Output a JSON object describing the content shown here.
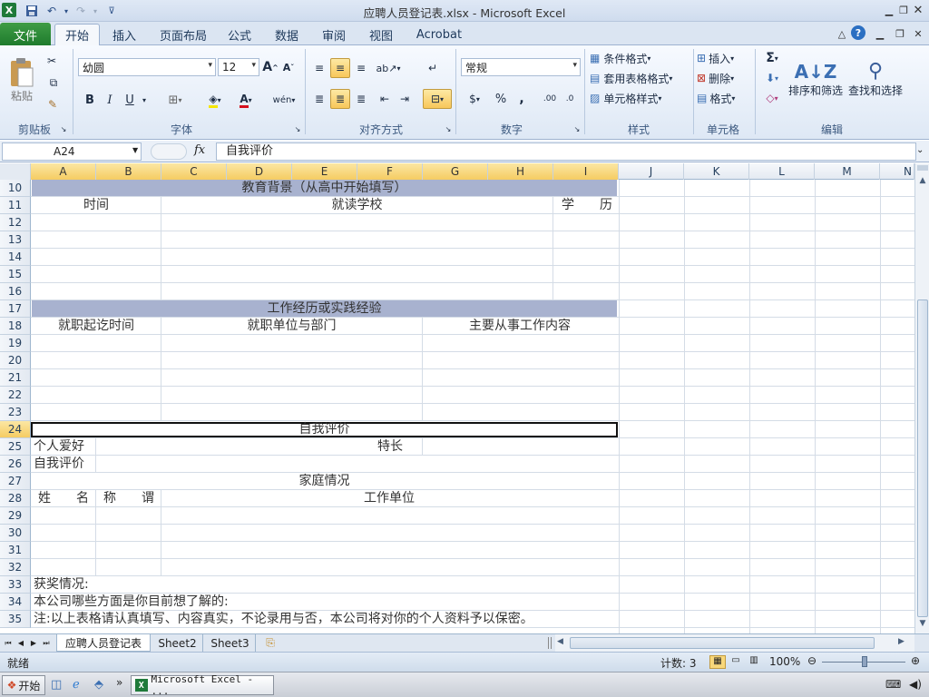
{
  "window": {
    "title": "应聘人员登记表.xlsx  -  Microsoft Excel"
  },
  "ribbon": {
    "tabs": [
      "文件",
      "开始",
      "插入",
      "页面布局",
      "公式",
      "数据",
      "审阅",
      "视图",
      "Acrobat"
    ],
    "clipboard": {
      "paste": "粘贴",
      "group": "剪贴板"
    },
    "font": {
      "name": "幼圆",
      "size": "12",
      "group": "字体",
      "bold": "B",
      "italic": "I",
      "underline": "U"
    },
    "alignment": {
      "group": "对齐方式"
    },
    "number": {
      "format": "常规",
      "group": "数字",
      "percent": "%",
      "comma": ","
    },
    "styles": {
      "conditional": "条件格式",
      "table": "套用表格格式",
      "cell": "单元格样式",
      "group": "样式"
    },
    "cells": {
      "insert": "插入",
      "delete": "删除",
      "format": "格式",
      "group": "单元格"
    },
    "editing": {
      "sort": "排序和筛选",
      "find": "查找和选择",
      "group": "编辑"
    }
  },
  "formula_bar": {
    "name_box": "A24",
    "fx": "fx",
    "content": "自我评价"
  },
  "columns": [
    "A",
    "B",
    "C",
    "D",
    "E",
    "F",
    "G",
    "H",
    "I",
    "J",
    "K",
    "L",
    "M",
    "N"
  ],
  "rows": [
    "10",
    "11",
    "12",
    "13",
    "14",
    "15",
    "16",
    "17",
    "18",
    "19",
    "20",
    "21",
    "22",
    "23",
    "24",
    "25",
    "26",
    "27",
    "28",
    "29",
    "30",
    "31",
    "32",
    "33",
    "34",
    "35"
  ],
  "cells": {
    "r10": "教育背景（从高中开始填写）",
    "r11_time": "时间",
    "r11_school": "就读学校",
    "r11_edu": "学　　历",
    "r17": "工作经历或实践经验",
    "r18_period": "就职起讫时间",
    "r18_unit": "就职单位与部门",
    "r18_duty": "主要从事工作内容",
    "r24": "自我评价",
    "r25_hobby": "个人爱好",
    "r25_skill": "特长",
    "r26": "自我评价",
    "r27": "家庭情况",
    "r28_name": "姓　　名",
    "r28_title": "称　　谓",
    "r28_work": "工作单位",
    "r33": "获奖情况:",
    "r34": "本公司哪些方面是你目前想了解的:",
    "r35": "注:以上表格请认真填写、内容真实，不论录用与否，本公司将对你的个人资料予以保密。"
  },
  "sheet_tabs": [
    "应聘人员登记表",
    "Sheet2",
    "Sheet3"
  ],
  "status": {
    "ready": "就绪",
    "count": "计数: 3",
    "zoom": "100%"
  },
  "taskbar": {
    "start": "开始",
    "task": "Microsoft Excel - ..."
  }
}
